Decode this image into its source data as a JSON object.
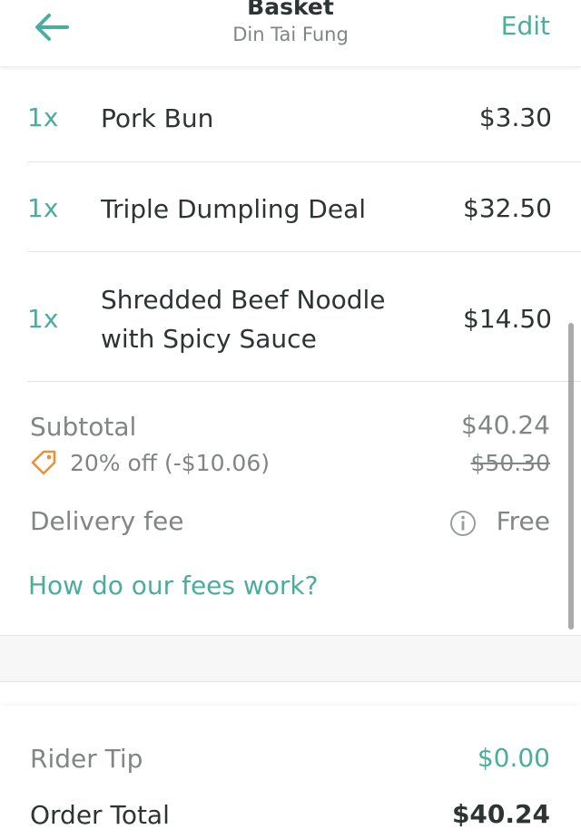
{
  "header": {
    "title": "Basket",
    "subtitle": "Din Tai Fung",
    "edit_label": "Edit",
    "back_icon": "arrow-left-icon"
  },
  "items": [
    {
      "qty": "1x",
      "name": "Pork Bun",
      "price": "$3.30"
    },
    {
      "qty": "1x",
      "name": "Triple Dumpling Deal",
      "price": "$32.50"
    },
    {
      "qty": "1x",
      "name_line1": "Shredded Beef Noodle",
      "name_line2": "with Spicy Sauce",
      "price": "$14.50"
    }
  ],
  "summary": {
    "subtotal_label": "Subtotal",
    "subtotal_value": "$40.24",
    "discount_label": "20% off (-$10.06)",
    "original_price": "$50.30",
    "delivery_label": "Delivery fee",
    "delivery_value": "Free",
    "fees_link": "How do our fees work?"
  },
  "totals": {
    "tip_label": "Rider Tip",
    "tip_value": "$0.00",
    "order_total_label": "Order Total",
    "order_total_value": "$40.24"
  },
  "colors": {
    "accent": "#4aae9f",
    "discount_tag": "#e8913b",
    "muted": "#828585",
    "text": "#2e3333"
  }
}
